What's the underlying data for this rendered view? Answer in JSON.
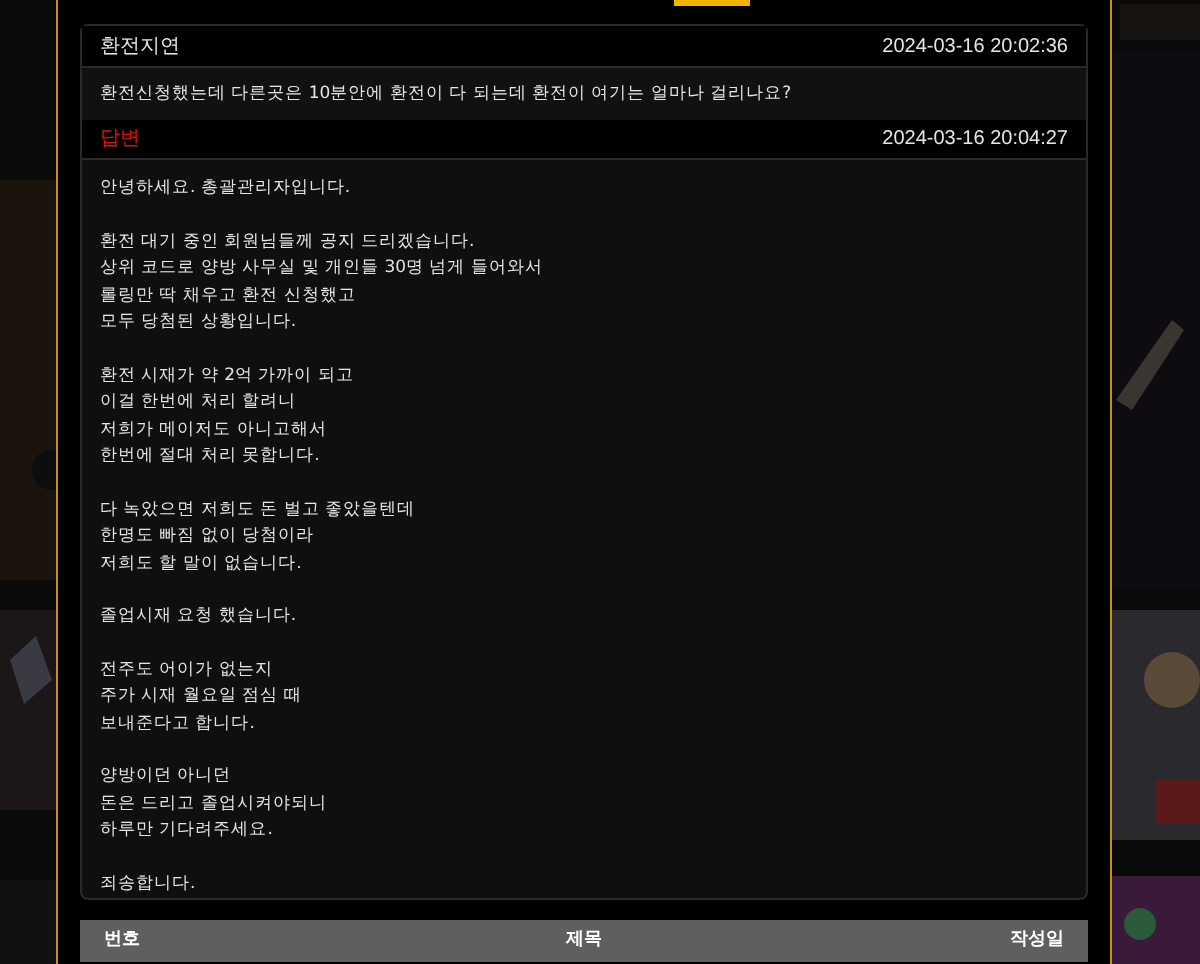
{
  "question": {
    "title": "환전지연",
    "date": "2024-03-16 20:02:36",
    "body": "환전신청했는데 다른곳은 10분안에 환전이 다 되는데 환전이 여기는 얼마나 걸리나요?"
  },
  "answer": {
    "label": "답변",
    "date": "2024-03-16 20:04:27",
    "paragraphs": [
      [
        "안녕하세요. 총괄관리자입니다."
      ],
      [
        "환전 대기 중인 회원님들께 공지 드리겠습니다.",
        "상위 코드로 양방 사무실 및 개인들 30명 넘게 들어와서",
        "롤링만 딱 채우고 환전 신청했고",
        "모두 당첨된 상황입니다."
      ],
      [
        "환전 시재가 약 2억 가까이 되고",
        "이걸 한번에 처리 할려니",
        "저희가 메이저도 아니고해서",
        "한번에 절대 처리 못합니다."
      ],
      [
        "다 녹았으면 저희도 돈 벌고 좋았을텐데",
        "한명도 빠짐 없이 당첨이라",
        "저희도 할 말이 없습니다."
      ],
      [
        "졸업시재 요청 했습니다."
      ],
      [
        "전주도 어이가 없는지",
        "주가 시재 월요일 점심 때",
        "보내준다고 합니다."
      ],
      [
        "양방이던 아니던",
        "돈은 드리고 졸업시켜야되니",
        "하루만 기다려주세요."
      ],
      [
        "죄송합니다."
      ]
    ]
  },
  "table": {
    "columns": [
      "번호",
      "제목",
      "작성일"
    ]
  }
}
